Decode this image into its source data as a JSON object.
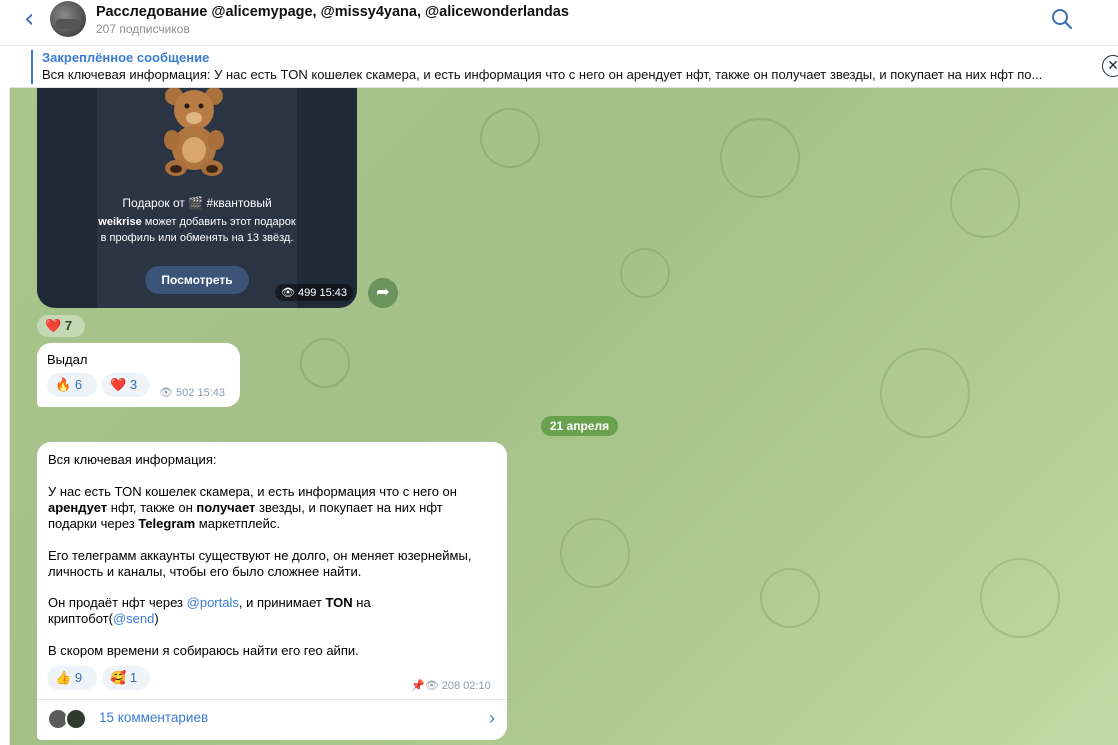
{
  "header": {
    "back_icon": "chevron-left-icon",
    "title": "Расследование @alicemypage, @missy4yana, @alicewonderlandas",
    "subscribers": "207 подписчиков",
    "search_icon": "search-icon"
  },
  "pinned": {
    "title": "Закреплённое сообщение",
    "text": "Вся ключевая информация:  У нас есть TON кошелек скамера, и есть информация что с него он арендует нфт, также он получает звезды, и покупает на них нфт по...",
    "close_icon": "close-icon"
  },
  "gift_message": {
    "line1": "Подарок от 🎬 #квантовый",
    "line2_bold": "weikrise",
    "line2": " может добавить этот подарок в профиль или обменять на 13 звёзд.",
    "button": "Посмотреть",
    "views": "499",
    "time": "15:43",
    "reaction_emoji": "❤️",
    "reaction_count": "7"
  },
  "message1": {
    "text": "Выдал",
    "reactions": [
      {
        "emoji": "🔥",
        "count": "6"
      },
      {
        "emoji": "❤️",
        "count": "3"
      }
    ],
    "views": "502",
    "time": "15:43"
  },
  "date_separator": "21 апреля",
  "message2": {
    "p1": "Вся ключевая информация:",
    "p2_a": "У нас есть TON кошелек скамера, и есть информация что с него он",
    "p2_b1": "арендует",
    "p2_b2": " нфт, также он ",
    "p2_b3": "получает",
    "p2_b4": " звезды, и покупает на них нфт",
    "p2_c1": "подарки через ",
    "p2_c2": "Telegram",
    "p2_c3": " маркетплейс.",
    "p3_a": "Его телеграмм аккаунты существуют не долго, он меняет юзернеймы,",
    "p3_b": "личность и каналы, чтобы его было сложнее найти.",
    "p4_a1": "Он продаёт нфт через ",
    "p4_a2": "@portals",
    "p4_a3": ", и принимает ",
    "p4_a4": "TON",
    "p4_a5": " на",
    "p4_b1": "криптобот(",
    "p4_b2": "@send",
    "p4_b3": ")",
    "p5": "В скором времени я собираюсь найти его гео айпи.",
    "reactions": [
      {
        "emoji": "👍",
        "count": "9"
      },
      {
        "emoji": "🥰",
        "count": "1"
      }
    ],
    "views": "208",
    "time": "02:10",
    "comments": "15 комментариев"
  }
}
